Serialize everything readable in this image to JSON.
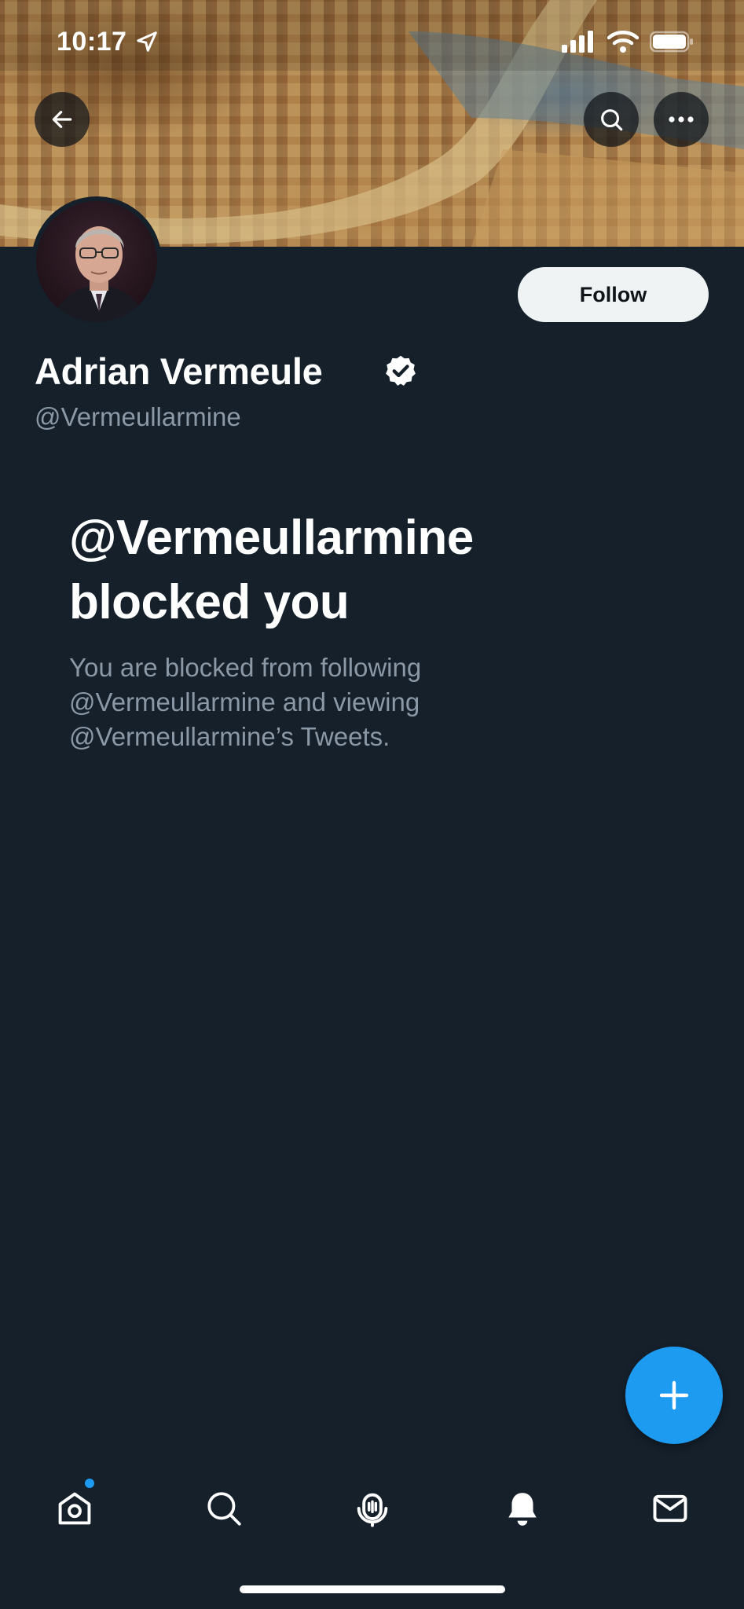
{
  "status_bar": {
    "time": "10:17"
  },
  "header": {
    "back_icon": "arrow-left-icon",
    "search_icon": "search-icon",
    "more_icon": "more-horizontal-icon"
  },
  "profile": {
    "display_name": "Adrian Vermeule",
    "handle": "@Vermeullarmine",
    "follow_label": "Follow",
    "verified": true
  },
  "blocked": {
    "title": "@Vermeullarmine blocked you",
    "body": "You are blocked from following @Vermeullarmine and viewing @Vermeullarmine’s Tweets."
  },
  "fab": {
    "icon": "plus-icon"
  },
  "bottom_nav": {
    "items": [
      {
        "name": "home",
        "icon": "home-icon",
        "has_notification_dot": true
      },
      {
        "name": "search",
        "icon": "search-icon"
      },
      {
        "name": "spaces",
        "icon": "spaces-microphone-icon"
      },
      {
        "name": "notifications",
        "icon": "bell-icon"
      },
      {
        "name": "messages",
        "icon": "mail-icon"
      }
    ]
  },
  "colors": {
    "background": "#15202b",
    "accent": "#1d9bf0",
    "secondary_text": "#8b98a5",
    "follow_button_bg": "#eff3f4"
  }
}
